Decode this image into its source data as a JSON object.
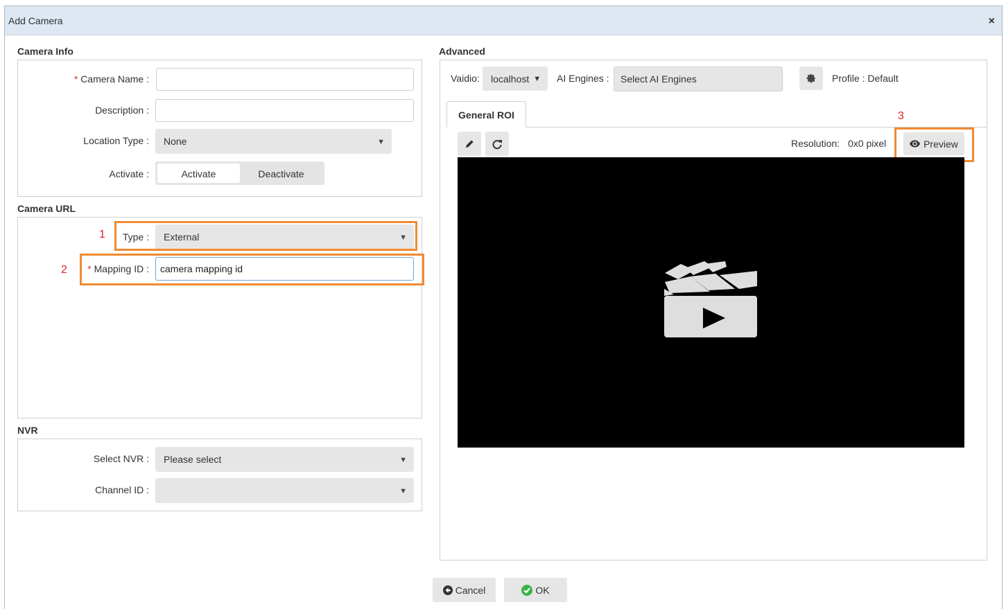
{
  "dialog": {
    "title": "Add Camera",
    "close_glyph": "×"
  },
  "camera_info": {
    "section_title": "Camera Info",
    "required_mark": "*",
    "camera_name": {
      "label": "Camera Name :",
      "value": ""
    },
    "description": {
      "label": "Description :",
      "value": ""
    },
    "location_type": {
      "label": "Location Type :",
      "selected": "None"
    },
    "activate": {
      "label": "Activate :",
      "options": [
        "Activate",
        "Deactivate"
      ],
      "selected": "Activate"
    }
  },
  "camera_url": {
    "section_title": "Camera URL",
    "type": {
      "label": "Type :",
      "selected": "External"
    },
    "mapping_id": {
      "label": "Mapping ID :",
      "value": "camera mapping id"
    }
  },
  "nvr": {
    "section_title": "NVR",
    "select_nvr": {
      "label": "Select NVR :",
      "selected": "Please select"
    },
    "channel_id": {
      "label": "Channel ID :",
      "selected": ""
    }
  },
  "advanced": {
    "section_title": "Advanced",
    "vaidio_label": "Vaidio:",
    "vaidio_selected": "localhost",
    "ai_engines_label": "AI Engines :",
    "ai_engines_placeholder": "Select AI Engines",
    "profile_text": "Profile : Default",
    "tab_label": "General ROI",
    "resolution_label": "Resolution:",
    "resolution_value": "0x0 pixel",
    "preview_label": "Preview"
  },
  "annotations": {
    "one": "1",
    "two": "2",
    "three": "3"
  },
  "footer": {
    "cancel_label": "Cancel",
    "ok_label": "OK"
  },
  "colors": {
    "highlight": "#f08a32",
    "annotation": "#e02020",
    "required": "#d9332a",
    "titlebar": "#dde8f2",
    "ok_icon": "#3cb34a"
  },
  "icons": [
    "close-icon",
    "caret-down-icon",
    "gear-icon",
    "pencil-icon",
    "refresh-icon",
    "eye-icon",
    "video-clapper-icon",
    "cancel-arrow-icon",
    "check-icon"
  ]
}
